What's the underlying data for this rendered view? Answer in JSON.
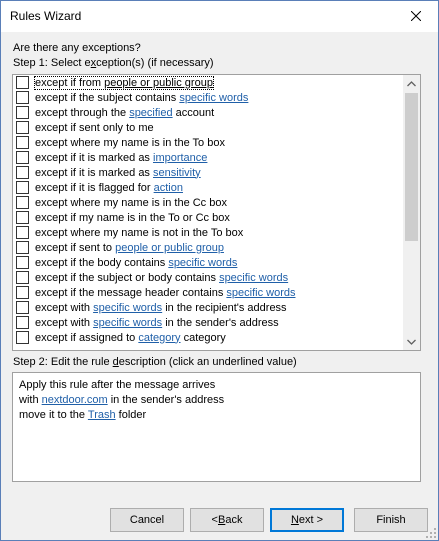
{
  "window": {
    "title": "Rules Wizard"
  },
  "question": "Are there any exceptions?",
  "step1": {
    "pre": "Step 1: Select e",
    "u": "x",
    "post": "ception(s) (if necessary)"
  },
  "exceptions": [
    {
      "pre": "except if from ",
      "link": "people or public group",
      "post": "",
      "selected": true,
      "dark": true
    },
    {
      "pre": "except if the subject contains ",
      "link": "specific words",
      "post": ""
    },
    {
      "pre": "except through the ",
      "link": "specified",
      "post": " account"
    },
    {
      "pre": "except if sent only to me",
      "link": "",
      "post": ""
    },
    {
      "pre": "except where my name is in the To box",
      "link": "",
      "post": ""
    },
    {
      "pre": "except if it is marked as ",
      "link": "importance",
      "post": ""
    },
    {
      "pre": "except if it is marked as ",
      "link": "sensitivity",
      "post": ""
    },
    {
      "pre": "except if it is flagged for ",
      "link": "action",
      "post": ""
    },
    {
      "pre": "except where my name is in the Cc box",
      "link": "",
      "post": ""
    },
    {
      "pre": "except if my name is in the To or Cc box",
      "link": "",
      "post": ""
    },
    {
      "pre": "except where my name is not in the To box",
      "link": "",
      "post": ""
    },
    {
      "pre": "except if sent to ",
      "link": "people or public group",
      "post": ""
    },
    {
      "pre": "except if the body contains ",
      "link": "specific words",
      "post": ""
    },
    {
      "pre": "except if the subject or body contains ",
      "link": "specific words",
      "post": ""
    },
    {
      "pre": "except if the message header contains ",
      "link": "specific words",
      "post": ""
    },
    {
      "pre": "except with ",
      "link": "specific words",
      "post": " in the recipient's address"
    },
    {
      "pre": "except with ",
      "link": "specific words",
      "post": " in the sender's address"
    },
    {
      "pre": "except if assigned to ",
      "link": "category",
      "post": " category"
    }
  ],
  "step2": {
    "pre": "Step 2: Edit the rule ",
    "u": "d",
    "post": "escription (click an underlined value)"
  },
  "description": {
    "line1": "Apply this rule after the message arrives",
    "line2_pre": "with ",
    "line2_link": "nextdoor.com",
    "line2_post": " in the sender's address",
    "line3_pre": "move it to the ",
    "line3_link": "Trash",
    "line3_post": " folder"
  },
  "buttons": {
    "cancel": "Cancel",
    "back_pre": "< ",
    "back_u": "B",
    "back_post": "ack",
    "next_u": "N",
    "next_post": "ext >",
    "finish": "Finish"
  }
}
